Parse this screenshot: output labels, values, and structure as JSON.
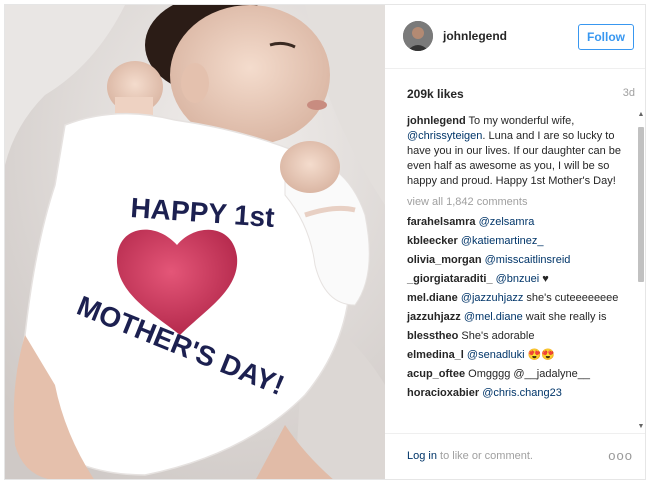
{
  "post": {
    "image_alt": "Baby in onesie",
    "onesie_text_line1": "HAPPY 1st",
    "onesie_text_line2": "MOTHER'S DAY!"
  },
  "header": {
    "username": "johnlegend",
    "follow_label": "Follow"
  },
  "meta": {
    "likes": "209k likes",
    "time": "3d"
  },
  "caption": {
    "user": "johnlegend",
    "text_before": "To my wonderful wife,",
    "mention": "@chrissyteigen",
    "text_after": ". Luna and I are so lucky to have you in our lives. If our daughter can be even half as awesome as you, I will be so happy and proud. Happy 1st Mother's Day!"
  },
  "view_all_label": "view all 1,842 comments",
  "comments": [
    {
      "user": "farahelsamra",
      "mention": "@zelsamra",
      "text": ""
    },
    {
      "user": "kbleecker",
      "mention": "@katiemartinez_",
      "text": ""
    },
    {
      "user": "olivia_morgan",
      "mention": "@misscaitlinsreid",
      "text": ""
    },
    {
      "user": "_giorgiataraditi_",
      "mention": "@bnzuei",
      "text": "♥"
    },
    {
      "user": "mel.diane",
      "mention": "@jazzuhjazz",
      "text": "she's cuteeeeeeee"
    },
    {
      "user": "jazzuhjazz",
      "mention": "@mel.diane",
      "text": "wait she really is"
    },
    {
      "user": "blesstheo",
      "mention": "",
      "text": "She's adorable"
    },
    {
      "user": "elmedina_l",
      "mention": "@senadluki",
      "text": "😍😍"
    },
    {
      "user": "acup_oftee",
      "mention": "",
      "text": "Omgggg @__jadalyne__"
    },
    {
      "user": "horacioxabier",
      "mention": "@chris.chang23",
      "text": ""
    }
  ],
  "footer": {
    "login_link": "Log in",
    "login_text": " to like or comment.",
    "more_label": "ooo"
  },
  "scrollbar": {
    "up": "▲",
    "down": "▼"
  }
}
